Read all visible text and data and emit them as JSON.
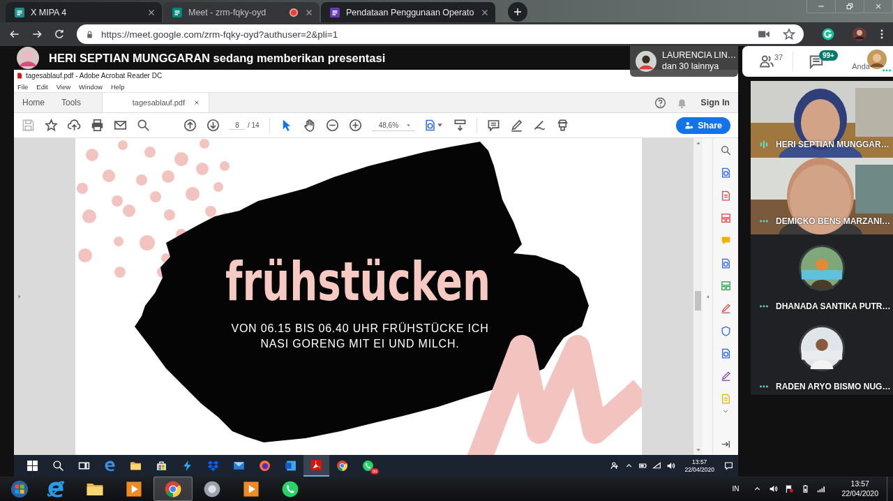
{
  "browser": {
    "tabs": [
      {
        "title": "X MIPA 4",
        "kind": "board",
        "selected": false,
        "recording": false
      },
      {
        "title": "Meet - zrm-fqky-oyd",
        "kind": "video",
        "selected": true,
        "recording": true
      },
      {
        "title": "Pendataan Penggunaan Operato",
        "kind": "list",
        "selected": false,
        "recording": false
      }
    ],
    "url": "https://meet.google.com/zrm-fqky-oyd?authuser=2&pli=1"
  },
  "meet": {
    "presenting_banner": "HERI SEPTIAN MUNGGARAN sedang memberikan presentasi",
    "notification": {
      "name": "LAURENCIA LIN…",
      "detail": "dan 30 lainnya"
    },
    "participant_count": "37",
    "chat_badge": "99+",
    "self_label": "Anda",
    "tiles": [
      {
        "name": "HERI SEPTIAN MUNGGAR…",
        "kind": "video",
        "speaking": true
      },
      {
        "name": "DEMICKO BENS MARZANI…",
        "kind": "video",
        "speaking": false
      },
      {
        "name": "DHANADA SANTIKA PUTR…",
        "kind": "avatar",
        "speaking": false
      },
      {
        "name": "RADEN ARYO BISMO NUG…",
        "kind": "avatar",
        "speaking": false
      }
    ]
  },
  "acrobat": {
    "title": "tagesablauf.pdf - Adobe Acrobat Reader DC",
    "menu": [
      "File",
      "Edit",
      "View",
      "Window",
      "Help"
    ],
    "tabs": [
      {
        "label": "Home",
        "selected": false
      },
      {
        "label": "Tools",
        "selected": false
      },
      {
        "label": "tagesablauf.pdf",
        "selected": true
      }
    ],
    "sign_in": "Sign In",
    "page": "8",
    "page_total": "/ 14",
    "zoom": "48,6%",
    "share": "Share",
    "document": {
      "heading": "frühstücken",
      "lines": [
        "VON 06.15 BIS 06.40 UHR FRÜHSTÜCKE ICH",
        "NASI GORENG MIT EI UND MILCH."
      ]
    }
  },
  "shared_taskbar": {
    "apps": [
      {
        "kind": "start",
        "active": false
      },
      {
        "kind": "search",
        "active": false
      },
      {
        "kind": "task-view",
        "active": false
      },
      {
        "kind": "edge",
        "active": false
      },
      {
        "kind": "folder",
        "active": false
      },
      {
        "kind": "store",
        "active": false
      },
      {
        "kind": "lightning",
        "active": false
      },
      {
        "kind": "box",
        "active": false
      },
      {
        "kind": "mail",
        "active": false
      },
      {
        "kind": "firefox",
        "active": false
      },
      {
        "kind": "word",
        "active": false
      },
      {
        "kind": "acrobat",
        "active": true
      },
      {
        "kind": "chrome",
        "active": false
      },
      {
        "kind": "whatsapp",
        "active": false,
        "badge": "99"
      }
    ],
    "time": "13:57",
    "date": "22/04/2020"
  },
  "taskbar": {
    "apps": [
      {
        "kind": "orb",
        "active": false
      },
      {
        "kind": "ie",
        "active": false
      },
      {
        "kind": "folder",
        "active": false
      },
      {
        "kind": "media",
        "active": false
      },
      {
        "kind": "chrome",
        "active": true
      },
      {
        "kind": "speaker",
        "active": false
      },
      {
        "kind": "media",
        "active": false
      },
      {
        "kind": "whatsapp",
        "active": false
      }
    ],
    "language": "IN",
    "time": "13:57",
    "date": "22/04/2020"
  }
}
